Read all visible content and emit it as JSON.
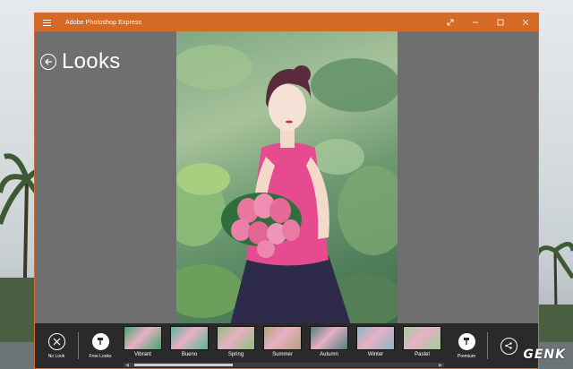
{
  "window": {
    "title": "Adobe Photoshop Express"
  },
  "page": {
    "title": "Looks"
  },
  "toolbar": {
    "no_look_label": "No Look",
    "free_looks_label": "Free Looks",
    "premium_label": "Premium",
    "looks": [
      {
        "label": "Vibrant",
        "tint": "#3fa86a"
      },
      {
        "label": "Bueno",
        "tint": "#56b79a"
      },
      {
        "label": "Spring",
        "tint": "#8fbf7a"
      },
      {
        "label": "Summer",
        "tint": "#b3a27a"
      },
      {
        "label": "Autumn",
        "tint": "#4f7f80"
      },
      {
        "label": "Winter",
        "tint": "#8ab6c9"
      },
      {
        "label": "Pastel",
        "tint": "#9ccf9a"
      }
    ]
  },
  "watermark": "GENK",
  "colors": {
    "titlebar": "#d46a26",
    "workspace": "#6f6f6f",
    "toolbar": "#2a2a2a"
  }
}
